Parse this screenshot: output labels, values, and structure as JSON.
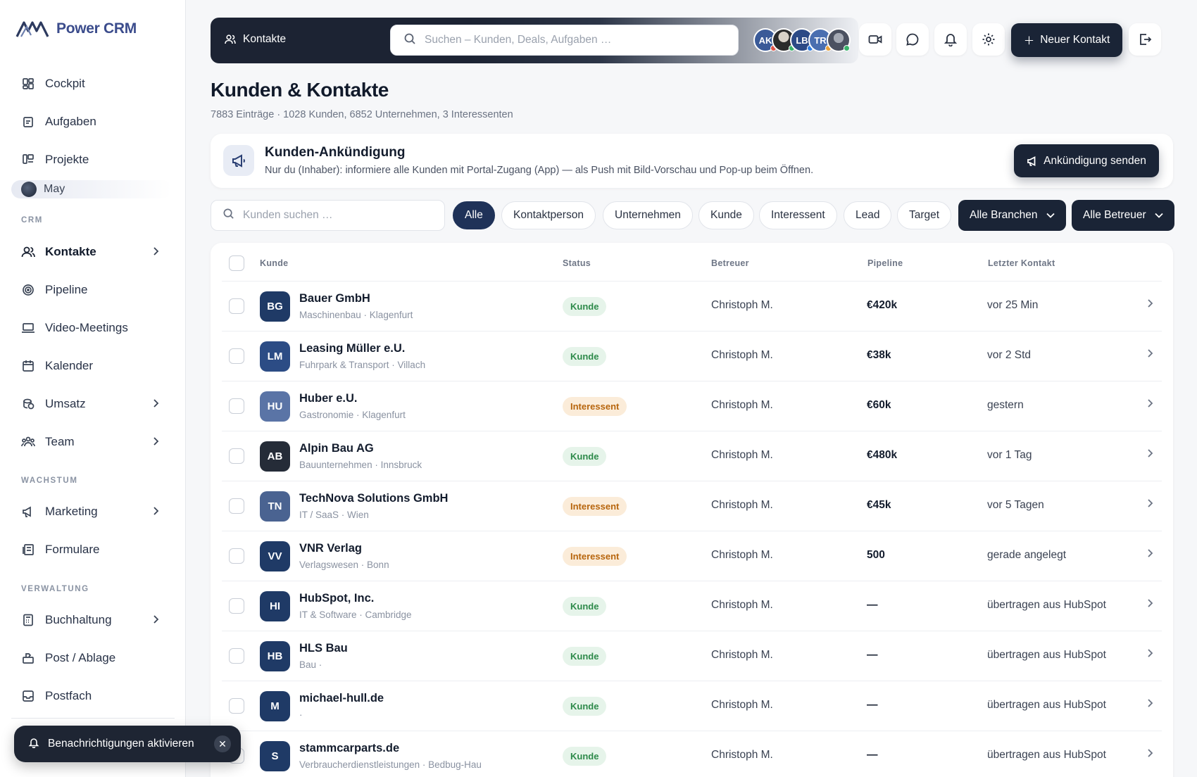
{
  "app": {
    "brand": "Power CRM"
  },
  "sidebar": {
    "items_top": [
      {
        "label": "Cockpit",
        "icon": "grid-icon"
      },
      {
        "label": "Aufgaben",
        "icon": "clipboard-icon"
      },
      {
        "label": "Projekte",
        "icon": "kanban-icon"
      }
    ],
    "user": "May",
    "sections": [
      "CRM",
      "WACHSTUM",
      "VERWALTUNG"
    ],
    "crm_items": [
      {
        "label": "Kontakte"
      },
      {
        "label": "Pipeline"
      },
      {
        "label": "Video-Meetings"
      },
      {
        "label": "Kalender"
      },
      {
        "label": "Umsatz"
      },
      {
        "label": "Team"
      }
    ],
    "wachstum_items": [
      {
        "label": "Marketing"
      },
      {
        "label": "Formulare"
      }
    ],
    "verwaltung_items": [
      {
        "label": "Buchhaltung"
      },
      {
        "label": "Post / Ablage"
      },
      {
        "label": "Postfach"
      }
    ]
  },
  "toast": {
    "label": "Benachrichtigungen aktivieren"
  },
  "topbar": {
    "crumb": "Kontakte",
    "search_placeholder": "Suchen – Kunden, Deals, Aufgaben …",
    "avatars": [
      "AK",
      "",
      "LB",
      "TR",
      ""
    ],
    "new_contact": "Neuer Kontakt"
  },
  "page": {
    "title": "Kunden & Kontakte",
    "subtitle": "7883 Einträge · 1028 Kunden, 6852 Unternehmen, 3 Interessenten"
  },
  "announcement": {
    "title": "Kunden-Ankündigung",
    "text": "Nur du (Inhaber): informiere alle Kunden mit Portal-Zugang (App) — als Push mit Bild-Vorschau und Pop-up beim Öffnen.",
    "button": "Ankündigung senden"
  },
  "filters": {
    "search_placeholder": "Kunden suchen …",
    "pills": [
      "Alle",
      "Kontaktperson",
      "Unternehmen",
      "Kunde",
      "Interessent",
      "Lead",
      "Target"
    ],
    "branchen": "Alle Branchen",
    "betreuer": "Alle Betreuer"
  },
  "table": {
    "headers": {
      "kunde": "Kunde",
      "status": "Status",
      "betreuer": "Betreuer",
      "pipeline": "Pipeline",
      "letzter": "Letzter Kontakt"
    },
    "rows": [
      {
        "initials": "BG",
        "color": "#1f3a66",
        "name": "Bauer GmbH",
        "meta": "Maschinenbau · Klagenfurt",
        "status": "Kunde",
        "kind": "kunde",
        "owner": "Christoph M.",
        "pipeline": "€420k",
        "last": "vor 25 Min"
      },
      {
        "initials": "LM",
        "color": "#2c4c85",
        "name": "Leasing Müller e.U.",
        "meta": "Fuhrpark & Transport · Villach",
        "status": "Kunde",
        "kind": "kunde",
        "owner": "Christoph M.",
        "pipeline": "€38k",
        "last": "vor 2 Std"
      },
      {
        "initials": "HU",
        "color": "#5a74a6",
        "name": "Huber e.U.",
        "meta": "Gastronomie · Klagenfurt",
        "status": "Interessent",
        "kind": "interessent",
        "owner": "Christoph M.",
        "pipeline": "€60k",
        "last": "gestern"
      },
      {
        "initials": "AB",
        "color": "#252c38",
        "name": "Alpin Bau AG",
        "meta": "Bauunternehmen · Innsbruck",
        "status": "Kunde",
        "kind": "kunde",
        "owner": "Christoph M.",
        "pipeline": "€480k",
        "last": "vor 1 Tag"
      },
      {
        "initials": "TN",
        "color": "#4a6391",
        "name": "TechNova Solutions GmbH",
        "meta": "IT / SaaS · Wien",
        "status": "Interessent",
        "kind": "interessent",
        "owner": "Christoph M.",
        "pipeline": "€45k",
        "last": "vor 5 Tagen"
      },
      {
        "initials": "VV",
        "color": "#1f3a66",
        "name": "VNR Verlag",
        "meta": "Verlagswesen · Bonn",
        "status": "Interessent",
        "kind": "interessent",
        "owner": "Christoph M.",
        "pipeline": "500",
        "last": "gerade angelegt"
      },
      {
        "initials": "HI",
        "color": "#1f3a66",
        "name": "HubSpot, Inc.",
        "meta": "IT & Software · Cambridge",
        "status": "Kunde",
        "kind": "kunde",
        "owner": "Christoph M.",
        "pipeline": "—",
        "last": "übertragen aus HubSpot"
      },
      {
        "initials": "HB",
        "color": "#1f3a66",
        "name": "HLS Bau",
        "meta": "Bau ·",
        "status": "Kunde",
        "kind": "kunde",
        "owner": "Christoph M.",
        "pipeline": "—",
        "last": "übertragen aus HubSpot"
      },
      {
        "initials": "M",
        "color": "#1f3a66",
        "name": "michael-hull.de",
        "meta": "·",
        "status": "Kunde",
        "kind": "kunde",
        "owner": "Christoph M.",
        "pipeline": "—",
        "last": "übertragen aus HubSpot"
      },
      {
        "initials": "S",
        "color": "#1f3a66",
        "name": "stammcarparts.de",
        "meta": "Verbraucherdienstleistungen · Bedbug-Hau",
        "status": "Kunde",
        "kind": "kunde",
        "owner": "Christoph M.",
        "pipeline": "—",
        "last": "übertragen aus HubSpot"
      }
    ]
  }
}
